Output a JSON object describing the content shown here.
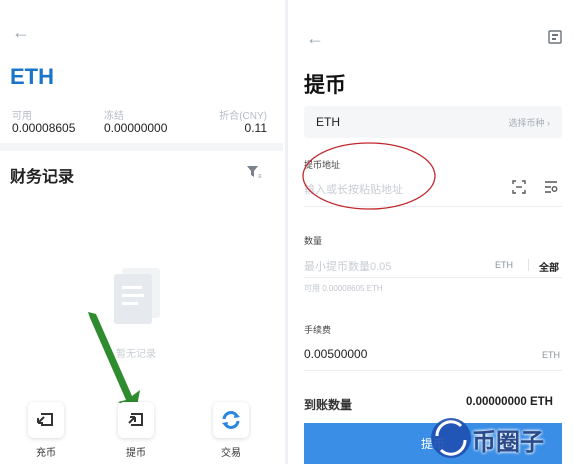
{
  "left": {
    "coin": "ETH",
    "stats": [
      {
        "label": "可用",
        "value": "0.00008605"
      },
      {
        "label": "冻结",
        "value": "0.00000000"
      },
      {
        "label": "折合(CNY)",
        "value": "0.11"
      }
    ],
    "section_title": "财务记录",
    "empty_text": "暂无记录",
    "nav": [
      {
        "label": "充币",
        "icon": "deposit-icon"
      },
      {
        "label": "提币",
        "icon": "withdraw-icon"
      },
      {
        "label": "交易",
        "icon": "trade-icon"
      }
    ]
  },
  "right": {
    "title": "提币",
    "coin_selector": {
      "symbol": "ETH",
      "action": "选择币种 ›"
    },
    "address": {
      "label": "提币地址",
      "placeholder": "输入或长按粘贴地址"
    },
    "amount": {
      "label": "数量",
      "placeholder": "最小提币数量0.05",
      "unit": "ETH",
      "all": "全部",
      "available_hint": "可用 0.00008605 ETH"
    },
    "fee": {
      "label": "手续费",
      "value": "0.00500000",
      "unit": "ETH"
    },
    "receive": {
      "label": "到账数量",
      "value": "0.00000000 ETH"
    },
    "submit_label": "提币"
  },
  "watermark": {
    "text": "币圈子"
  },
  "colors": {
    "accent": "#1a74c8",
    "button": "#3a8ee6",
    "annotation_red": "#c0272d",
    "annotation_green": "#2e8b2e"
  }
}
